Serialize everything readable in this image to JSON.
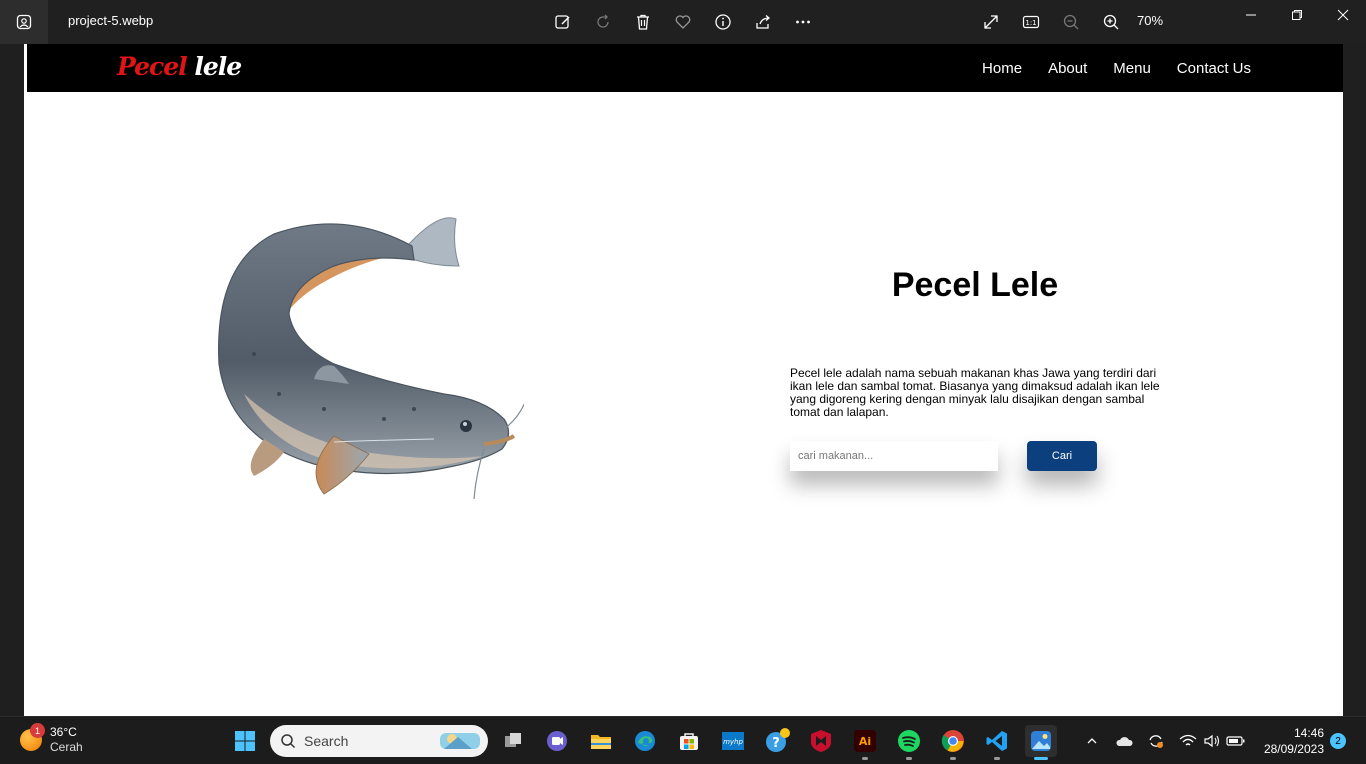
{
  "titlebar": {
    "filename": "project-5.webp",
    "zoom": "70%",
    "tools": [
      "edit-icon",
      "rotate-icon",
      "delete-icon",
      "favorite-icon",
      "info-icon",
      "share-icon",
      "more-icon"
    ],
    "view_tools": [
      "fullscreen-icon",
      "actual-size-icon",
      "zoom-out-icon",
      "zoom-in-icon"
    ]
  },
  "webpage": {
    "logo": {
      "part1": "Pecel",
      "part2": "lele",
      "colors": {
        "part1": "#e01414",
        "part2": "#ffffff"
      }
    },
    "nav": [
      {
        "label": "Home"
      },
      {
        "label": "About"
      },
      {
        "label": "Menu"
      },
      {
        "label": "Contact Us"
      }
    ],
    "hero": {
      "title": "Pecel Lele",
      "description": "Pecel lele adalah nama sebuah makanan khas Jawa yang terdiri dari ikan lele dan sambal tomat. Biasanya yang dimaksud adalah ikan lele yang digoreng kering dengan minyak lalu disajikan dengan sambal tomat dan lalapan.",
      "search_placeholder": "cari makanan...",
      "search_button": "Cari",
      "button_color": "#0b3f7e"
    }
  },
  "taskbar": {
    "weather": {
      "temp": "36°C",
      "condition": "Cerah",
      "badge": "1"
    },
    "search_label": "Search",
    "apps": [
      "start-icon",
      "task-view-icon",
      "teams-icon",
      "file-explorer-icon",
      "edge-icon",
      "store-icon",
      "myhp-icon",
      "help-icon",
      "mcafee-icon",
      "illustrator-icon",
      "spotify-icon",
      "chrome-icon",
      "vscode-icon",
      "photos-icon"
    ],
    "clock": {
      "time": "14:46",
      "date": "28/09/2023"
    },
    "notifications": "2"
  }
}
